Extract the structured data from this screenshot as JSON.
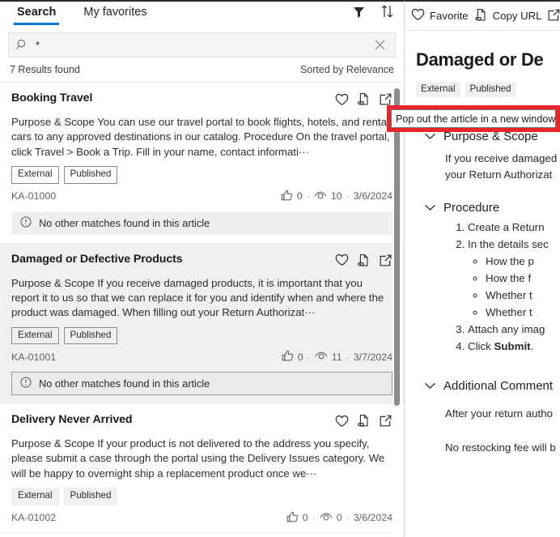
{
  "left": {
    "tabs": [
      {
        "label": "Search",
        "active": true
      },
      {
        "label": "My favorites",
        "active": false
      }
    ],
    "toolbar": {
      "filter_icon": "filter-icon",
      "sort_icon": "sort-icon"
    },
    "search": {
      "value": "*",
      "placeholder": "",
      "search_icon": "search-icon",
      "clear_icon": "clear-icon"
    },
    "results_count": "7 Results found",
    "sort_label": "Sorted by Relevance",
    "cards": [
      {
        "title": "Booking Travel",
        "snippet": "Purpose & Scope You can use our travel portal to book flights, hotels, and rental cars to any approved destinations in our catalog. Procedure On the travel portal, click Travel > Book a Trip. Fill in your name, contact informati···",
        "tags": [
          "External",
          "Published"
        ],
        "tag_style": "bordered",
        "article_id": "KA-01000",
        "likes": "0",
        "views": "10",
        "date": "3/6/2024",
        "no_match_text": "No other matches found in this article",
        "selected": false
      },
      {
        "title": "Damaged or Defective Products",
        "snippet": "  Purpose & Scope If you receive damaged products, it is important that you report it to us so that we can replace it for you and identify when and where the product was damaged. When filling out your Return Authorizat···",
        "tags": [
          "External",
          "Published"
        ],
        "tag_style": "bordered",
        "article_id": "KA-01001",
        "likes": "0",
        "views": "11",
        "date": "3/7/2024",
        "no_match_text": "No other matches found in this article",
        "selected": true
      },
      {
        "title": "Delivery Never Arrived",
        "snippet": "Purpose & Scope If your product is not delivered to the address you specify, please submit a case through the portal using the Delivery Issues category. We will be happy to overnight ship a replacement product once we···",
        "tags": [
          "External",
          "Published"
        ],
        "tag_style": "filled",
        "article_id": "KA-01002",
        "likes": "0",
        "views": "0",
        "date": "3/6/2024",
        "no_match_text": "",
        "selected": false
      }
    ]
  },
  "right": {
    "toolbar": {
      "favorite_label": "Favorite",
      "favorite_icon": "heart-icon",
      "copy_url_label": "Copy URL",
      "copy_url_icon": "copy-url-icon",
      "popout_icon": "pop-out-icon"
    },
    "article_title": "Damaged or De",
    "tags": [
      "External",
      "Published"
    ],
    "sections": [
      {
        "heading": "Purpose & Scope",
        "chevron": "chevron-down-icon",
        "paragraphs": [
          "If you receive damaged",
          "your Return Authorizat"
        ]
      },
      {
        "heading": "Procedure",
        "chevron": "chevron-down-icon",
        "ordered": [
          "Create a Return ",
          "In the details sec"
        ],
        "sub_items": [
          "How the p",
          "How the f",
          "Whether t",
          "Whether t"
        ],
        "ordered_tail": [
          "Attach any imag",
          "Click Submit."
        ]
      },
      {
        "heading": "Additional Comment",
        "chevron": "chevron-down-icon",
        "paragraphs": [
          "After your return autho",
          "No restocking fee will b"
        ]
      }
    ]
  },
  "overlay": {
    "tooltip_text": "Pop out the article in a new window",
    "highlight_color": "#e8252a"
  }
}
